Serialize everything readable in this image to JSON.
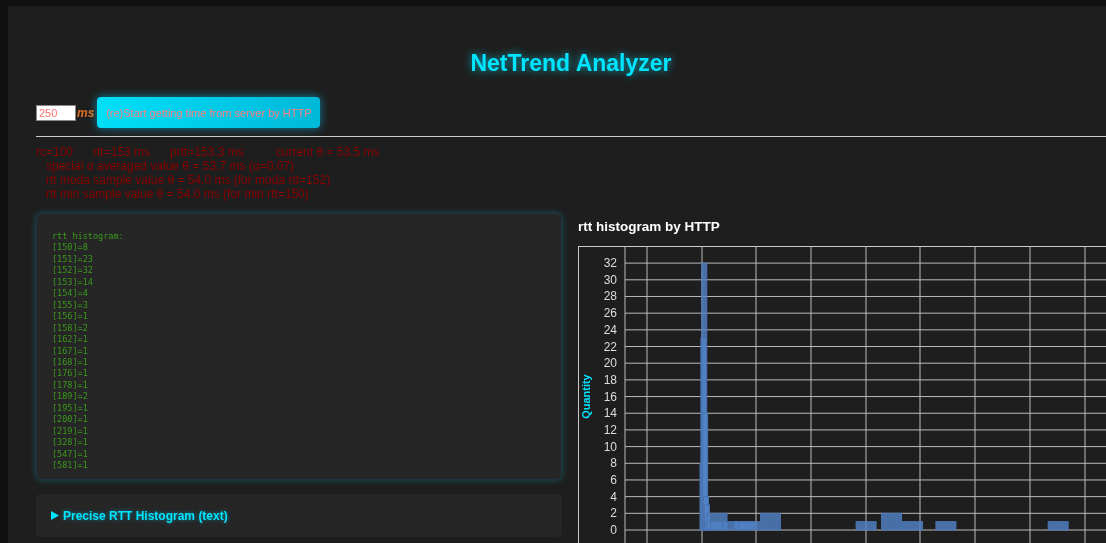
{
  "title": "NetTrend Analyzer",
  "controls": {
    "interval": "250",
    "unit": "ms",
    "start_button": "(re)Start getting time from server by HTTP"
  },
  "stats": {
    "summary": [
      "rc=100",
      "rtt=153 ms",
      "prtt=153.3 ms",
      "current θ = 53.5 ms"
    ],
    "details": [
      "special α averaged value θ = 53.7 ms (α=0.07)",
      "rtt moda sample value θ = 54.0 ms (for moda rtt=152)",
      "rtt min sample value θ = 54.0 ms (for min rtt=150)"
    ]
  },
  "histogram_text": {
    "heading": "rtt histogram:",
    "lines": [
      "[150]=8",
      "[151]=23",
      "[152]=32",
      "[153]=14",
      "[154]=4",
      "[155]=3",
      "[156]=1",
      "[158]=2",
      "[162]=1",
      "[167]=1",
      "[168]=1",
      "[176]=1",
      "[178]=1",
      "[189]=2",
      "[195]=1",
      "[200]=1",
      "[219]=1",
      "[328]=1",
      "[547]=1",
      "[581]=1"
    ]
  },
  "details_toggle": {
    "label": "Precise RTT Histogram (text)",
    "expanded": false
  },
  "chart": {
    "title": "rtt histogram by HTTP",
    "ylabel": "Quantity",
    "y_tick_labels": [
      "32",
      "30",
      "28",
      "26",
      "24",
      "22",
      "20",
      "18",
      "16",
      "14",
      "12",
      "10",
      "8",
      "6",
      "4",
      "2",
      "0"
    ]
  }
}
